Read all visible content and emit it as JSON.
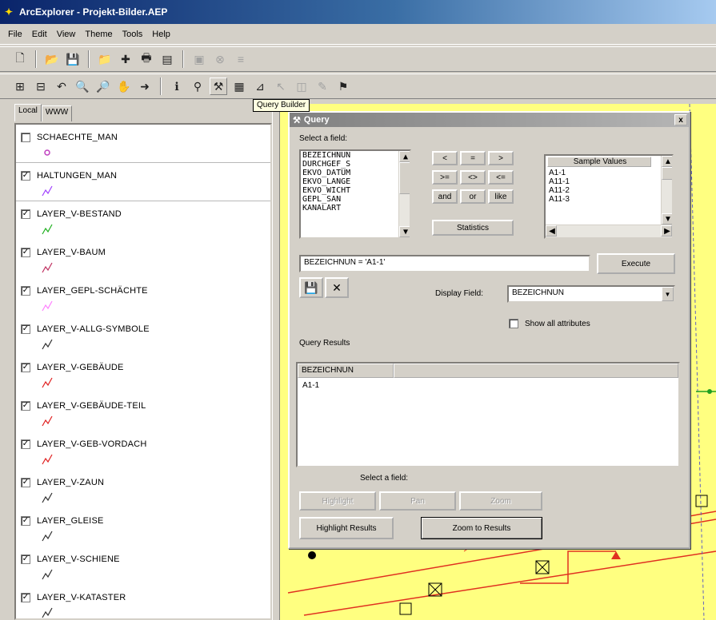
{
  "window": {
    "title": "ArcExplorer - Projekt-Bilder.AEP"
  },
  "menu": [
    "File",
    "Edit",
    "View",
    "Theme",
    "Tools",
    "Help"
  ],
  "tooltip": "Query Builder",
  "tabs": [
    "Local",
    "WWW"
  ],
  "layers": [
    {
      "name": "SCHAECHTE_MAN",
      "checked": false,
      "color": "#c040c0"
    },
    {
      "name": "HALTUNGEN_MAN",
      "checked": true,
      "color": "#a040ff"
    },
    {
      "name": "LAYER_V-BESTAND",
      "checked": true,
      "color": "#20b020"
    },
    {
      "name": "LAYER_V-BAUM",
      "checked": true,
      "color": "#c03060"
    },
    {
      "name": "LAYER_GEPL-SCHÄCHTE",
      "checked": true,
      "color": "#ff80ff"
    },
    {
      "name": "LAYER_V-ALLG-SYMBOLE",
      "checked": true,
      "color": "#303030"
    },
    {
      "name": "LAYER_V-GEBÄUDE",
      "checked": true,
      "color": "#e02020"
    },
    {
      "name": "LAYER_V-GEBÄUDE-TEIL",
      "checked": true,
      "color": "#e02020"
    },
    {
      "name": "LAYER_V-GEB-VORDACH",
      "checked": true,
      "color": "#e02020"
    },
    {
      "name": "LAYER_V-ZAUN",
      "checked": true,
      "color": "#303030"
    },
    {
      "name": "LAYER_GLEISE",
      "checked": true,
      "color": "#303030"
    },
    {
      "name": "LAYER_V-SCHIENE",
      "checked": true,
      "color": "#303030"
    },
    {
      "name": "LAYER_V-KATASTER",
      "checked": true,
      "color": "#303030"
    }
  ],
  "query": {
    "title": "Query",
    "close": "x",
    "select_field_label": "Select a field:",
    "fields": [
      "BEZEICHNUN",
      "DURCHGEF_S",
      "EKVO_DATUM",
      "EKVO_LANGE",
      "EKVO_WICHT",
      "GEPL_SAN",
      "KANALART"
    ],
    "operators": [
      "<",
      "=",
      ">",
      ">=",
      "<>",
      "<=",
      "and",
      "or",
      "like"
    ],
    "sample_values_header": "Sample Values",
    "sample_values": [
      "A1-1",
      "A11-1",
      "A11-2",
      "A11-3"
    ],
    "statistics": "Statistics",
    "expression": "BEZEICHNUN = 'A1-1'",
    "execute": "Execute",
    "display_field_label": "Display Field:",
    "display_field": "BEZEICHNUN",
    "show_all_attributes": "Show all attributes",
    "query_results_label": "Query Results",
    "results_header": "BEZEICHNUN",
    "results": [
      "A1-1"
    ],
    "select_field_hint": "Select a field:",
    "highlight": "Highlight",
    "pan": "Pan",
    "zoom": "Zoom",
    "highlight_results": "Highlight Results",
    "zoom_to_results": "Zoom to Results"
  }
}
